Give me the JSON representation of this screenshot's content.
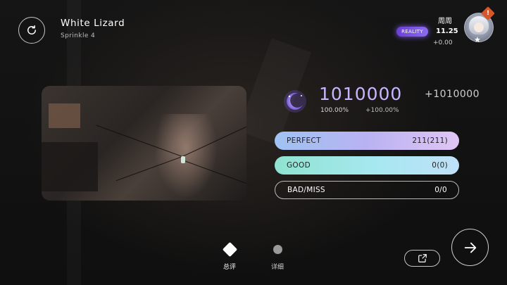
{
  "song": {
    "title": "White Lizard",
    "difficulty": "Sprinkle 4"
  },
  "player": {
    "name": "周周",
    "badge": "REALITY",
    "rks": "11.25",
    "rks_delta": "+0.00",
    "notification": "!"
  },
  "result": {
    "score": "1010000",
    "score_delta": "+1010000",
    "accuracy": "100.00%",
    "accuracy_delta": "+100.00%"
  },
  "judgements": [
    {
      "label": "PERFECT",
      "value": "211(211)"
    },
    {
      "label": "GOOD",
      "value": "0(0)"
    },
    {
      "label": "BAD/MISS",
      "value": "0/0"
    }
  ],
  "tabs": [
    {
      "label": "总评",
      "icon": "diamond-icon",
      "selected": true
    },
    {
      "label": "详细",
      "icon": "dot-icon",
      "selected": false
    }
  ],
  "icons": {
    "retry": "retry-icon",
    "share": "share-icon",
    "next": "arrow-right-icon",
    "rank": "moon-icon",
    "avatar_star": "star-icon"
  },
  "colors": {
    "accent": "#c7b6ff",
    "reality_badge": "#7a55e6",
    "notify": "#d8572a"
  }
}
